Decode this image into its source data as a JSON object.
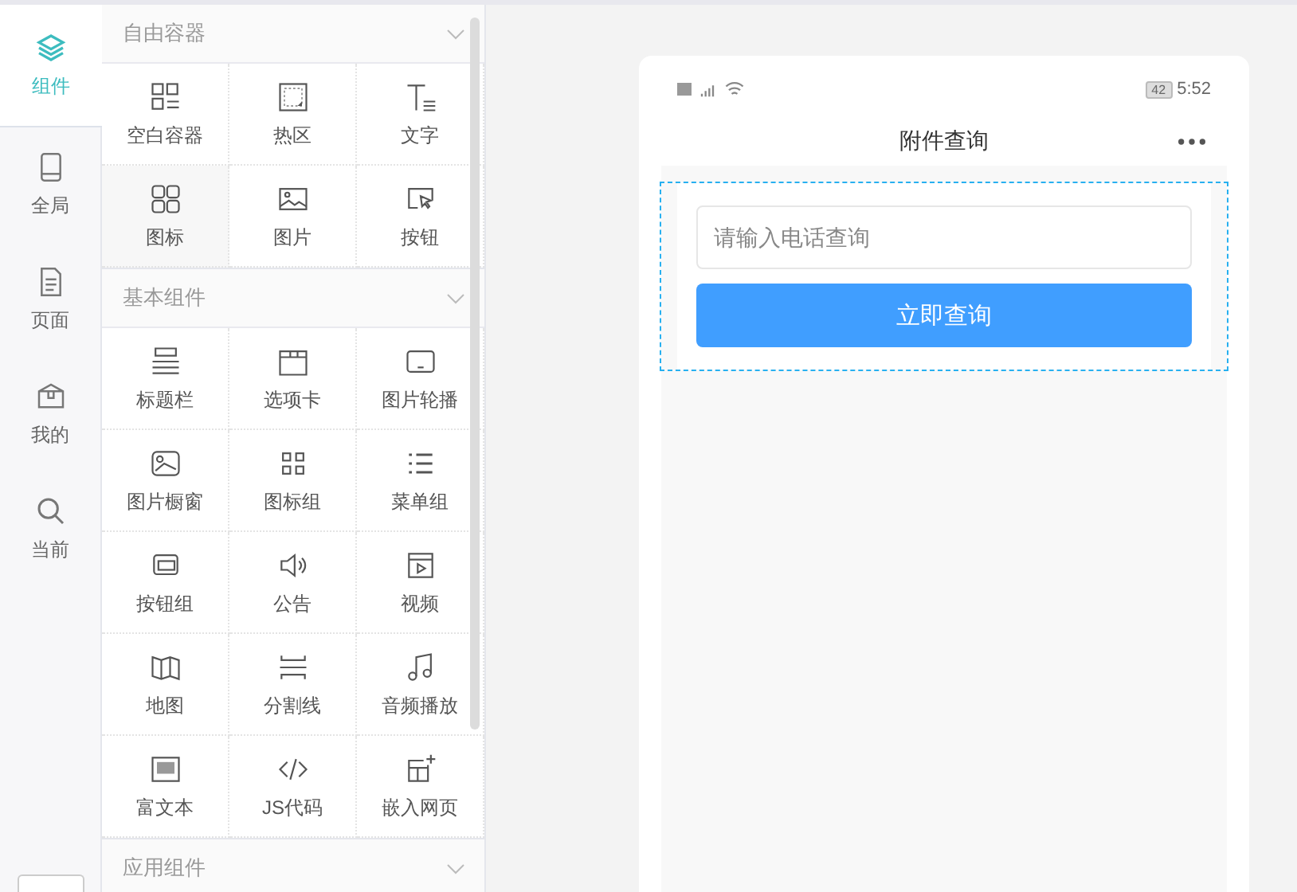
{
  "nav": [
    {
      "label": "组件",
      "selected": true
    },
    {
      "label": "全局",
      "selected": false
    },
    {
      "label": "页面",
      "selected": false
    },
    {
      "label": "我的",
      "selected": false
    },
    {
      "label": "当前",
      "selected": false
    }
  ],
  "sections": [
    {
      "title": "自由容器",
      "expanded": true,
      "items": [
        {
          "label": "空白容器",
          "hovered": false
        },
        {
          "label": "热区",
          "hovered": false
        },
        {
          "label": "文字",
          "hovered": false
        },
        {
          "label": "图标",
          "hovered": true
        },
        {
          "label": "图片",
          "hovered": false
        },
        {
          "label": "按钮",
          "hovered": false
        }
      ]
    },
    {
      "title": "基本组件",
      "expanded": true,
      "items": [
        {
          "label": "标题栏",
          "hovered": false
        },
        {
          "label": "选项卡",
          "hovered": false
        },
        {
          "label": "图片轮播",
          "hovered": false
        },
        {
          "label": "图片橱窗",
          "hovered": false
        },
        {
          "label": "图标组",
          "hovered": false
        },
        {
          "label": "菜单组",
          "hovered": false
        },
        {
          "label": "按钮组",
          "hovered": false
        },
        {
          "label": "公告",
          "hovered": false
        },
        {
          "label": "视频",
          "hovered": false
        },
        {
          "label": "地图",
          "hovered": false
        },
        {
          "label": "分割线",
          "hovered": false
        },
        {
          "label": "音频播放",
          "hovered": false
        },
        {
          "label": "富文本",
          "hovered": false
        },
        {
          "label": "JS代码",
          "hovered": false
        },
        {
          "label": "嵌入网页",
          "hovered": false
        }
      ]
    },
    {
      "title": "应用组件",
      "expanded": false
    }
  ],
  "phone": {
    "status_time": "5:52",
    "battery": "42",
    "title": "附件查询",
    "search": {
      "placeholder": "请输入电话查询"
    },
    "button": "立即查询"
  }
}
